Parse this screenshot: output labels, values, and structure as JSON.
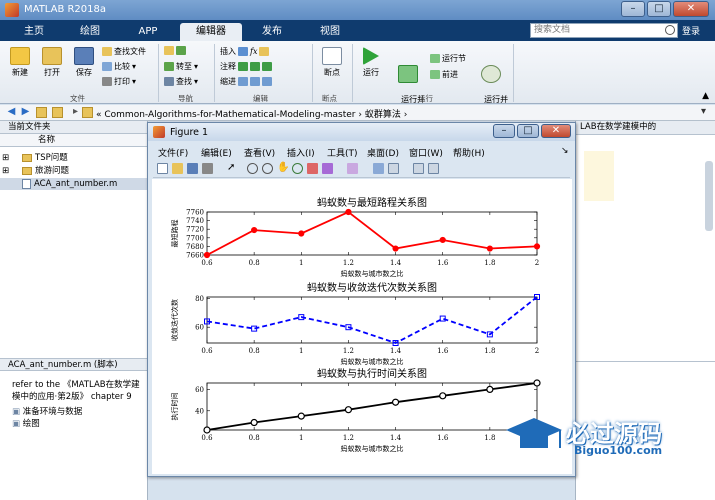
{
  "app": {
    "title": "MATLAB R2018a"
  },
  "tabs": [
    {
      "label": "主页"
    },
    {
      "label": "绘图"
    },
    {
      "label": "APP"
    },
    {
      "label": "编辑器"
    },
    {
      "label": "发布"
    },
    {
      "label": "视图"
    }
  ],
  "search": {
    "placeholder": "搜索文档"
  },
  "login": "登录",
  "ribbon": {
    "new": "新建",
    "open": "打开",
    "save": "保存",
    "find_files": "查找文件",
    "compare": "比较",
    "print": "打印",
    "goto": "转至",
    "find": "查找",
    "insert": "插入",
    "comment": "注释",
    "indent": "缩进",
    "breakpoint": "断点",
    "run": "运行",
    "run_advance": "运行并\n前进",
    "run_section": "运行节",
    "advance": "前进",
    "run_time": "运行并\n计时",
    "group_file": "文件",
    "group_nav": "导航",
    "group_edit": "编辑",
    "group_bp": "断点",
    "group_run": "运行"
  },
  "address": {
    "path": "« Common-Algorithms-for-Mathematical-Modeling-master › 蚁群算法 ›"
  },
  "left_panel": {
    "header": "当前文件夹",
    "col_name": "名称",
    "items": [
      {
        "label": "TSP问题",
        "type": "folder"
      },
      {
        "label": "旅游问题",
        "type": "folder"
      },
      {
        "label": "ACA_ant_number.m",
        "type": "file"
      }
    ],
    "details_title": "ACA_ant_number.m  (脚本)",
    "details_text1": "refer to the 《MATLAB在数学建",
    "details_text2": "模中的应用·第2版》 chapter 9",
    "sections": [
      "准备环境与数据",
      "绘图"
    ]
  },
  "right_panel": {
    "text": "LAB在数学建模中的"
  },
  "figure": {
    "title": "Figure 1",
    "menu": [
      "文件(F)",
      "编辑(E)",
      "查看(V)",
      "插入(I)",
      "工具(T)",
      "桌面(D)",
      "窗口(W)",
      "帮助(H)"
    ]
  },
  "watermark": {
    "cn": "必过源码",
    "en": "Biguo100.com"
  },
  "chart_data": [
    {
      "type": "line",
      "title": "蚂蚁数与最短路程关系图",
      "xlabel": "蚂蚁数与城市数之比",
      "ylabel": "最短路程",
      "x": [
        0.6,
        0.8,
        1.0,
        1.2,
        1.4,
        1.6,
        1.8,
        2.0
      ],
      "series": [
        {
          "values": [
            7660,
            7718,
            7710,
            7760,
            7675,
            7695,
            7675,
            7680
          ],
          "color": "#ff0000",
          "marker": "circle",
          "style": "solid"
        }
      ],
      "xlim": [
        0.6,
        2.0
      ],
      "ylim": [
        7660,
        7760
      ],
      "xticks": [
        "0.6",
        "0.8",
        "1",
        "1.2",
        "1.4",
        "1.6",
        "1.8",
        "2"
      ],
      "yticks": [
        "7660",
        "7680",
        "7700",
        "7720",
        "7740",
        "7760"
      ]
    },
    {
      "type": "line",
      "title": "蚂蚁数与收敛迭代次数关系图",
      "xlabel": "蚂蚁数与城市数之比",
      "ylabel": "收敛迭代次数",
      "x": [
        0.6,
        0.8,
        1.0,
        1.2,
        1.4,
        1.6,
        1.8,
        2.0
      ],
      "series": [
        {
          "values": [
            64,
            59,
            67,
            60,
            49,
            66,
            55,
            81
          ],
          "color": "#0000ff",
          "marker": "square",
          "style": "dashed"
        }
      ],
      "xlim": [
        0.6,
        2.0
      ],
      "ylim": [
        49,
        81
      ],
      "xticks": [
        "0.6",
        "0.8",
        "1",
        "1.2",
        "1.4",
        "1.6",
        "1.8",
        "2"
      ],
      "yticks": [
        "60",
        "80"
      ]
    },
    {
      "type": "line",
      "title": "蚂蚁数与执行时间关系图",
      "xlabel": "蚂蚁数与城市数之比",
      "ylabel": "执行时间",
      "x": [
        0.6,
        0.8,
        1.0,
        1.2,
        1.4,
        1.6,
        1.8,
        2.0
      ],
      "series": [
        {
          "values": [
            22,
            29,
            35,
            41,
            48,
            54,
            60,
            66
          ],
          "color": "#000000",
          "marker": "circle",
          "style": "solid"
        }
      ],
      "xlim": [
        0.6,
        2.0
      ],
      "ylim": [
        22,
        66
      ],
      "xticks": [
        "0.6",
        "0.8",
        "1",
        "1.2",
        "1.4",
        "1.6",
        "1.8",
        "2"
      ],
      "yticks": [
        "40",
        "60"
      ]
    }
  ]
}
